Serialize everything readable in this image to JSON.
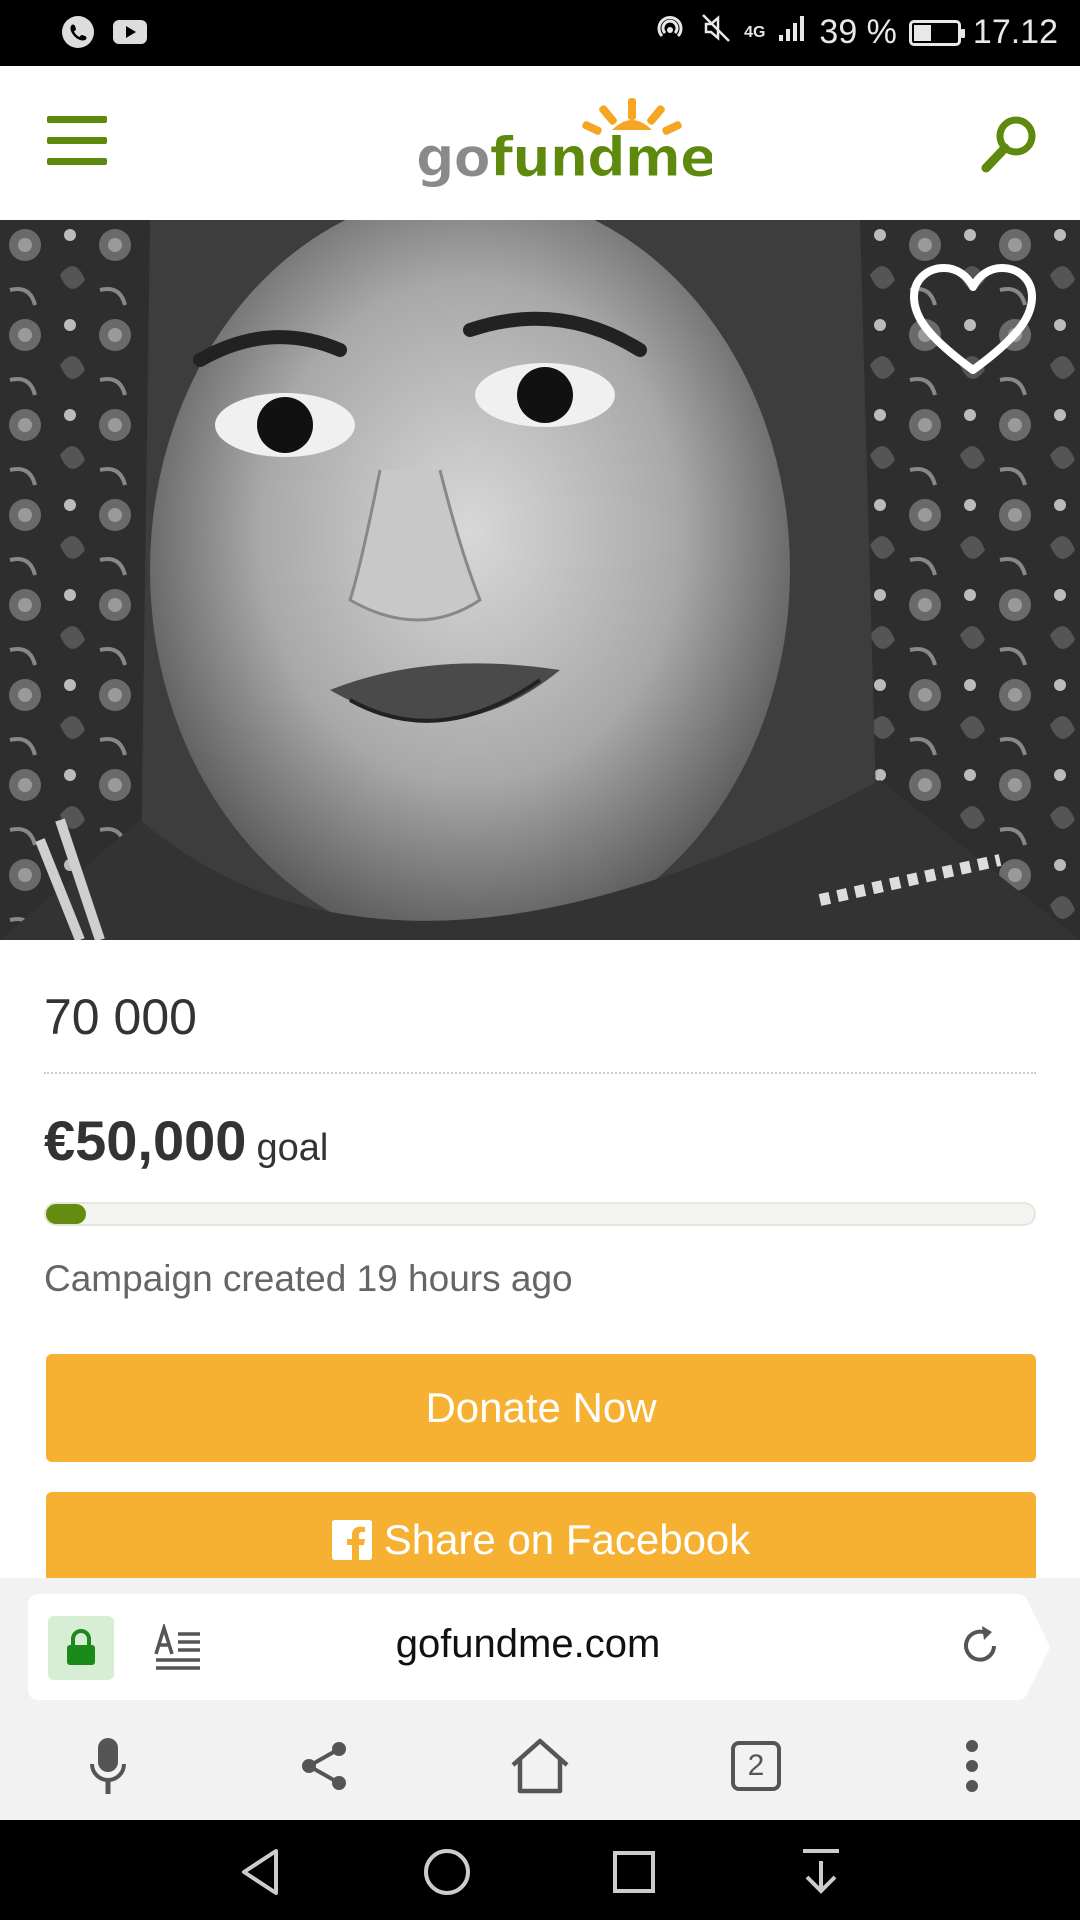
{
  "status_bar": {
    "signal_label": "4G",
    "battery_percent": "39 %",
    "time": "17.12"
  },
  "header": {
    "logo_text": "gofundme",
    "menu_icon": "hamburger-menu-icon",
    "search_icon": "search-icon"
  },
  "hero": {
    "favorite_icon": "heart-icon"
  },
  "campaign": {
    "title": "70 000",
    "goal_amount": "€50,000",
    "goal_label": "goal",
    "progress_fraction": 0.04,
    "created_text": "Campaign created 19 hours ago"
  },
  "buttons": {
    "donate_label": "Donate Now",
    "share_label": "Share on Facebook"
  },
  "browser": {
    "url": "gofundme.com",
    "tab_count": "2"
  },
  "colors": {
    "brand_green": "#5d8a0d",
    "button_orange": "#f6b132",
    "logo_orange": "#f5a623"
  }
}
